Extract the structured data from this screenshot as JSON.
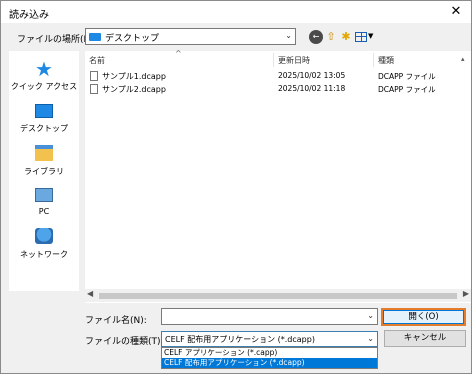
{
  "window": {
    "title": "読み込み",
    "close_glyph": "✕"
  },
  "location": {
    "label": "ファイルの場所(I):",
    "value": "デスクトップ"
  },
  "places": [
    {
      "label": "クイック アクセス"
    },
    {
      "label": "デスクトップ"
    },
    {
      "label": "ライブラリ"
    },
    {
      "label": "PC"
    },
    {
      "label": "ネットワーク"
    }
  ],
  "file_list": {
    "columns": [
      "名前",
      "更新日時",
      "種類"
    ],
    "files": [
      {
        "name": "サンプル1.dcapp",
        "modified": "2025/10/02 13:05",
        "type": "DCAPP ファイル"
      },
      {
        "name": "サンプル2.dcapp",
        "modified": "2025/10/02 11:18",
        "type": "DCAPP ファイル"
      }
    ]
  },
  "filename": {
    "label": "ファイル名(N):",
    "value": ""
  },
  "filetype": {
    "label": "ファイルの種類(T):",
    "selected": "CELF 配布用アプリケーション (*.dcapp)",
    "options": [
      "CELF アプリケーション (*.capp)",
      "CELF 配布用アプリケーション (*.dcapp)"
    ]
  },
  "buttons": {
    "open": "開く(O)",
    "cancel": "キャンセル"
  },
  "colors": {
    "accent": "#0078d7",
    "focus_outline": "#e47c2c",
    "folder": "#1e88e5"
  },
  "icons": [
    "back-icon",
    "up-folder-icon",
    "new-folder-icon",
    "view-menu-icon",
    "quick-access-icon",
    "desktop-icon",
    "library-icon",
    "pc-icon",
    "network-icon",
    "file-icon"
  ]
}
